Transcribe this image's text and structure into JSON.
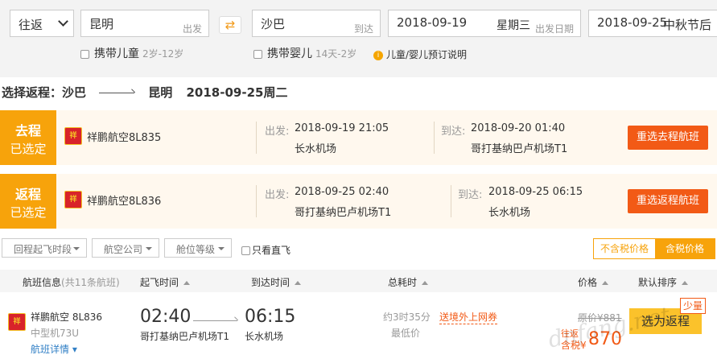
{
  "search": {
    "trip_type": "往返",
    "from_city": "昆明",
    "from_tag": "出发",
    "swap_icon": "⇄",
    "to_city": "沙巴",
    "to_tag": "到达",
    "depart_date": "2018-09-19",
    "depart_weekday": "星期三",
    "depart_tag": "出发日期",
    "return_date": "2018-09-25",
    "return_weekday": "中秋节后"
  },
  "options": {
    "child_label": "携带儿童",
    "child_age": "2岁-12岁",
    "infant_label": "携带婴儿",
    "infant_age": "14天-2岁",
    "info_label": "儿童/婴儿预订说明"
  },
  "heading": {
    "prefix": "选择返程：沙巴",
    "dest": "昆明",
    "date": "2018-09-25周二"
  },
  "legs": [
    {
      "badge_title": "去程",
      "badge_sub": "已选定",
      "logo_text": "祥",
      "airline": "祥鹏航空8L835",
      "dep_label": "出发:",
      "dep_time": "2018-09-19 21:05",
      "dep_airport": "长水机场",
      "arr_label": "到达:",
      "arr_time": "2018-09-20 01:40",
      "arr_airport": "哥打基纳巴卢机场T1",
      "button": "重选去程航班"
    },
    {
      "badge_title": "返程",
      "badge_sub": "已选定",
      "logo_text": "祥",
      "airline": "祥鹏航空8L836",
      "dep_label": "出发:",
      "dep_time": "2018-09-25 02:40",
      "dep_airport": "哥打基纳巴卢机场T1",
      "arr_label": "到达:",
      "arr_time": "2018-09-25 06:15",
      "arr_airport": "长水机场",
      "button": "重选返程航班"
    }
  ],
  "filters": {
    "items": [
      "回程起飞时段",
      "航空公司",
      "舱位等级"
    ],
    "direct_only": "只看直飞",
    "tax_excluded": "不含税价格",
    "tax_included": "含税价格"
  },
  "table_header": {
    "flight_info": "航班信息",
    "flight_count": "(共11条航班)",
    "dep_time": "起飞时间",
    "arr_time": "到达时间",
    "duration": "总耗时",
    "price": "价格",
    "sort": "默认排序"
  },
  "flight_row": {
    "logo_text": "祥",
    "airline": "祥鹏航空 8L836",
    "plane": "中型机73U",
    "detail": "航班详情",
    "dep_time": "02:40",
    "dep_airport": "哥打基纳巴卢机场T1",
    "arr_time": "06:15",
    "arr_airport": "长水机场",
    "duration": "约3时35分",
    "lowest": "最低价",
    "promo": "送境外上网券",
    "orig_price": "原价¥881",
    "price_label_top": "往返",
    "price_label_bottom": "含税¥",
    "price": "870",
    "select_button": "选为返程",
    "few_badge": "少量"
  },
  "watermark": "dnfang.net",
  "colors": {
    "accent_orange": "#f7a30b",
    "button_red": "#f25a16",
    "select_yellow": "#fbc22b",
    "link_blue": "#3280c6"
  }
}
